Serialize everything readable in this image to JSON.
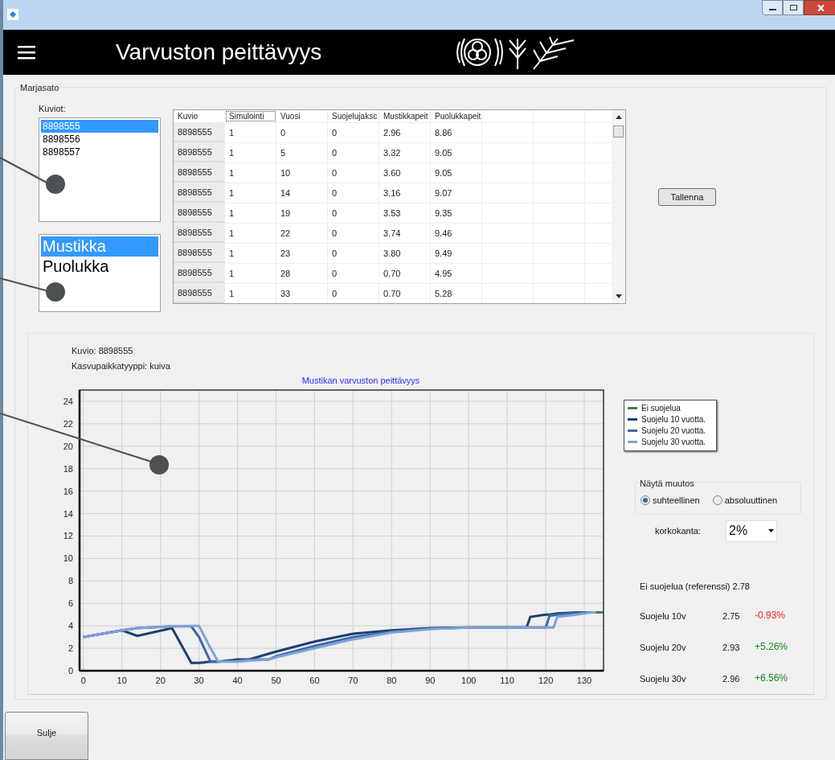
{
  "header": {
    "title": "Varvuston peittävyys"
  },
  "group": {
    "title": "Marjasato"
  },
  "kuviot": {
    "label": "Kuviot:",
    "items": [
      {
        "text": "8898555",
        "selected": true
      },
      {
        "text": "8898556",
        "selected": false
      },
      {
        "text": "8898557",
        "selected": false
      }
    ]
  },
  "species": {
    "items": [
      {
        "text": "Mustikka",
        "selected": true
      },
      {
        "text": "Puolukka",
        "selected": false
      }
    ]
  },
  "table": {
    "columns": [
      "Kuvio",
      "Simulointi",
      "Vuosi",
      "Suojelujaksc",
      "Mustikkapeit",
      "Puolukkapeit"
    ],
    "rows": [
      [
        "8898555",
        "1",
        "0",
        "0",
        "2.96",
        "8.86"
      ],
      [
        "8898555",
        "1",
        "5",
        "0",
        "3.32",
        "9.05"
      ],
      [
        "8898555",
        "1",
        "10",
        "0",
        "3.60",
        "9.05"
      ],
      [
        "8898555",
        "1",
        "14",
        "0",
        "3.16",
        "9.07"
      ],
      [
        "8898555",
        "1",
        "19",
        "0",
        "3.53",
        "9.35"
      ],
      [
        "8898555",
        "1",
        "22",
        "0",
        "3.74",
        "9.46"
      ],
      [
        "8898555",
        "1",
        "23",
        "0",
        "3.80",
        "9.49"
      ],
      [
        "8898555",
        "1",
        "28",
        "0",
        "0.70",
        "4.95"
      ],
      [
        "8898555",
        "1",
        "33",
        "0",
        "0.70",
        "5.28"
      ]
    ]
  },
  "save_button": "Tallenna",
  "chart_panel": {
    "info": [
      "Kuvio: 8898555",
      "Kasvupaikkatyyppi: kuiva"
    ],
    "chart_data": {
      "type": "line",
      "title": "Mustikan varvuston peittävyys",
      "x": [
        0,
        10,
        14,
        23,
        28,
        30,
        33,
        35,
        40,
        43,
        48,
        50,
        60,
        70,
        80,
        90,
        100,
        110,
        115,
        116,
        120,
        121,
        122,
        123,
        128,
        131,
        132,
        133,
        135
      ],
      "series": [
        {
          "name": "Ei suojelua",
          "color": "#4a7a4f",
          "values": [
            null,
            null,
            null,
            null,
            null,
            null,
            null,
            null,
            null,
            null,
            null,
            null,
            null,
            null,
            null,
            null,
            null,
            null,
            null,
            null,
            null,
            null,
            null,
            null,
            null,
            5.2,
            5.2,
            5.2,
            5.2
          ]
        },
        {
          "name": "Suojelu 10 vuotta.",
          "color": "#1f3f73",
          "values": [
            3.0,
            3.6,
            3.1,
            3.8,
            0.7,
            0.7,
            0.8,
            0.8,
            1.0,
            1.0,
            1.5,
            1.7,
            2.6,
            3.3,
            3.6,
            3.8,
            3.85,
            3.85,
            3.85,
            4.8,
            5.0,
            5.0,
            5.05,
            5.1,
            5.2,
            5.2,
            null,
            null,
            null
          ]
        },
        {
          "name": "Suojelu 20 vuotta.",
          "color": "#3d67a8",
          "values": [
            3.0,
            3.6,
            3.8,
            3.95,
            3.95,
            3.0,
            0.8,
            0.8,
            0.9,
            1.0,
            1.0,
            1.3,
            2.2,
            3.0,
            3.5,
            3.75,
            3.85,
            3.85,
            3.85,
            3.85,
            3.85,
            4.9,
            4.95,
            5.0,
            5.15,
            5.2,
            5.2,
            null,
            null
          ]
        },
        {
          "name": "Suojelu 30 vuotta.",
          "color": "#7fa2d6",
          "values": [
            3.0,
            3.6,
            3.8,
            3.95,
            4.0,
            4.0,
            2.0,
            0.8,
            0.8,
            0.9,
            1.0,
            1.2,
            2.0,
            2.8,
            3.4,
            3.7,
            3.85,
            3.85,
            3.85,
            3.85,
            3.85,
            3.85,
            3.85,
            4.8,
            5.0,
            5.15,
            5.2,
            5.2,
            null
          ]
        }
      ],
      "grid": true,
      "xlim": [
        -1,
        135
      ],
      "ylim": [
        0,
        25
      ],
      "xticks": [
        0,
        10,
        20,
        30,
        40,
        50,
        60,
        70,
        80,
        90,
        100,
        110,
        120,
        130
      ],
      "yticks": [
        0,
        2,
        4,
        6,
        8,
        10,
        12,
        14,
        16,
        18,
        20,
        22,
        24
      ]
    }
  },
  "display_change": {
    "title": "Näytä muutos",
    "options": [
      {
        "label": "suhteellinen",
        "selected": true
      },
      {
        "label": "absoluuttinen",
        "selected": false
      }
    ]
  },
  "interest": {
    "label": "korkokanta:",
    "value": "2%"
  },
  "reference": "Ei suojelua (referenssi) 2.78",
  "results": [
    {
      "label": "Suojelu 10v",
      "value": "2.75",
      "change": "-0.93%",
      "color": "#ff2020"
    },
    {
      "label": "Suojelu 20v",
      "value": "2.93",
      "change": "+5.26%",
      "color": "#1a8a1a"
    },
    {
      "label": "Suojelu 30v",
      "value": "2.96",
      "change": "+6.56%",
      "color": "#1a8a1a"
    }
  ],
  "close_button": "Sulje"
}
